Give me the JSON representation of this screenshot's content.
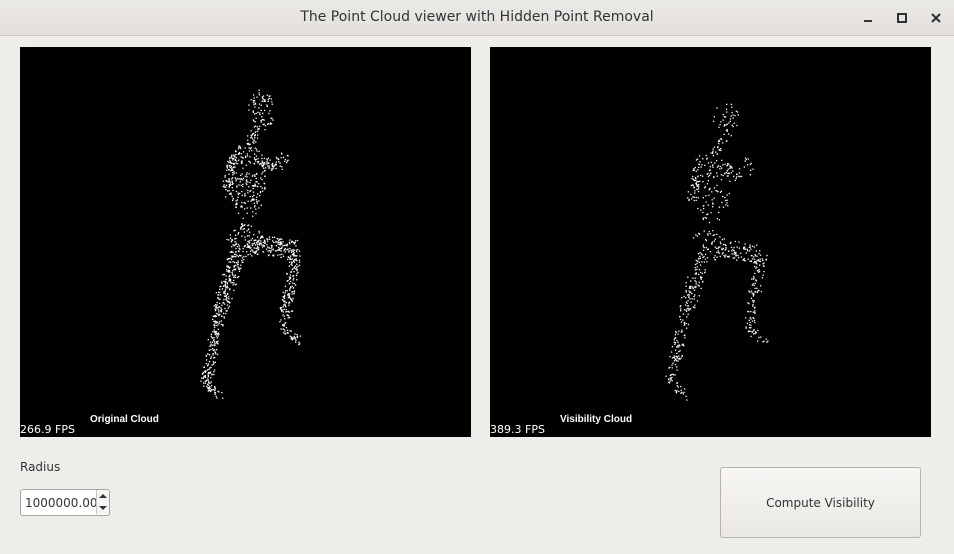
{
  "window": {
    "title": "The Point Cloud viewer with Hidden Point Removal",
    "controls": [
      "minimize-icon",
      "maximize-icon",
      "close-icon"
    ]
  },
  "left_view": {
    "fps": "266.9 FPS",
    "label": "Original Cloud",
    "background": "#000000",
    "point_color": "#ffffff"
  },
  "right_view": {
    "fps": "389.3 FPS",
    "label": "Visibility Cloud",
    "background": "#000000",
    "point_color": "#ffffff"
  },
  "controls": {
    "radius_label": "Radius",
    "radius_value": "1000000.00",
    "compute_button": "Compute Visibility"
  }
}
